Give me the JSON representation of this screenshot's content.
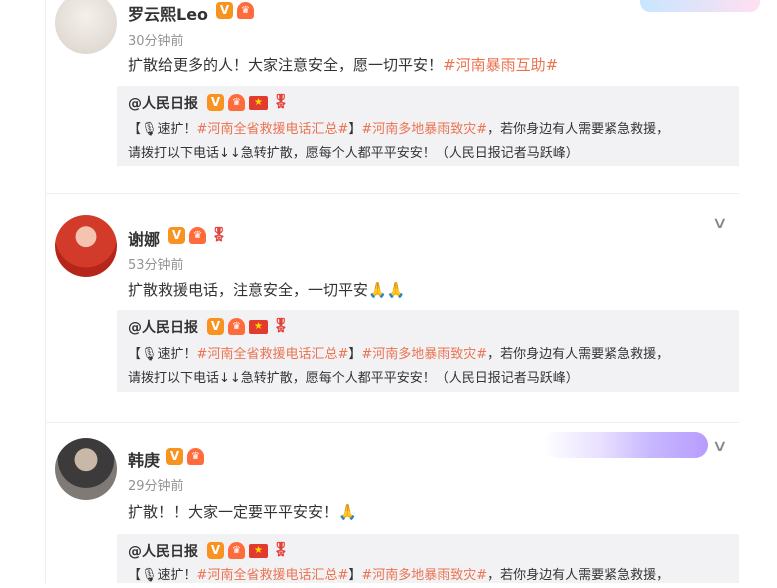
{
  "posts": [
    {
      "author": "罗云熙Leo",
      "time": "30分钟前",
      "content": "扩散给更多的人！大家注意安全，愿一切平安！",
      "topic": "#河南暴雨互助#",
      "avatar_icon": "avatar-photo",
      "quote": {
        "author": "@人民日报",
        "line1_prefix": "【",
        "line1_label": "速扩！",
        "line1_topic1": "#河南全省救援电话汇总#",
        "line1_close": "】",
        "line1_topic2": "#河南多地暴雨致灾#",
        "line1_suffix": "，若你身边有人需要紧急救援，",
        "line2": "请拨打以下电话↓↓急转扩散，愿每个人都平平安安！（人民日报记者马跃峰）"
      }
    },
    {
      "author": "谢娜",
      "time": "53分钟前",
      "content": "扩散救援电话，注意安全，一切平安",
      "emoji": "🙏🙏",
      "avatar_icon": "avatar-photo",
      "quote": {
        "author": "@人民日报",
        "line1_prefix": "【",
        "line1_label": "速扩！",
        "line1_topic1": "#河南全省救援电话汇总#",
        "line1_close": "】",
        "line1_topic2": "#河南多地暴雨致灾#",
        "line1_suffix": "，若你身边有人需要紧急救援，",
        "line2": "请拨打以下电话↓↓急转扩散，愿每个人都平平安安！（人民日报记者马跃峰）"
      }
    },
    {
      "author": "韩庚",
      "time": "29分钟前",
      "content": "扩散！！大家一定要平平安安！",
      "emoji": "🙏",
      "avatar_icon": "avatar-photo",
      "quote": {
        "author": "@人民日报",
        "line1_prefix": "【",
        "line1_label": "速扩！",
        "line1_topic1": "#河南全省救援电话汇总#",
        "line1_close": "】",
        "line1_topic2": "#河南多地暴雨致灾#",
        "line1_suffix": "，若你身边有人需要紧急救援，"
      }
    }
  ],
  "badges": {
    "v": "V",
    "vip": "♛",
    "flag": "★",
    "medal": "🎖"
  },
  "chevron": "∨",
  "colors": {
    "topic": "#eb7350",
    "quote_bg": "#f2f2f5",
    "badge_v": "#f7931e"
  }
}
